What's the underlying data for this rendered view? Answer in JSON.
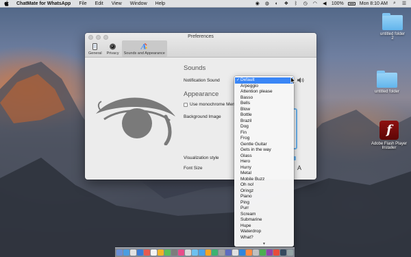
{
  "menubar": {
    "app_name": "ChatMate for WhatsApp",
    "menus": [
      "File",
      "Edit",
      "View",
      "Window",
      "Help"
    ],
    "battery": "100%",
    "clock": "Mon 8:10 AM"
  },
  "desktop": {
    "icons": [
      {
        "label": "untitled folder 2"
      },
      {
        "label": "untitled folder"
      },
      {
        "label": "Adobe Flash Player Installer"
      }
    ]
  },
  "window": {
    "title": "Preferences",
    "toolbar": [
      {
        "label": "General",
        "icon": "phone-icon"
      },
      {
        "label": "Privacy",
        "icon": "camera-icon"
      },
      {
        "label": "Sounds and Appearance",
        "icon": "palette-icon"
      }
    ],
    "sounds": {
      "section_title": "Sounds",
      "notification_label": "Notification Sound"
    },
    "appearance": {
      "section_title": "Appearance",
      "monochrome_label": "Use monochrome Menu",
      "background_label": "Background Image",
      "visualization_label": "Visualization style",
      "font_size_label": "Font Size",
      "font_size_glyph": "A"
    }
  },
  "sound_dropdown": {
    "selected": "Default",
    "options": [
      "Default",
      "Arpeggio",
      "Attention please",
      "Basso",
      "Bells",
      "Blow",
      "Bottle",
      "Brazil",
      "Dog",
      "Fin",
      "Frog",
      "Gentle Guitar",
      "Gets in the way",
      "Glass",
      "Hero",
      "Hurry",
      "Metal",
      "Mobile Buzz",
      "Oh no!",
      "Oringz",
      "Piano",
      "Ping",
      "Purr",
      "Scream",
      "Submarine",
      "Hupe",
      "Waterdrop",
      "What?"
    ]
  },
  "colors": {
    "selection": "#3a86f6",
    "accent": "#6ab3ee"
  }
}
